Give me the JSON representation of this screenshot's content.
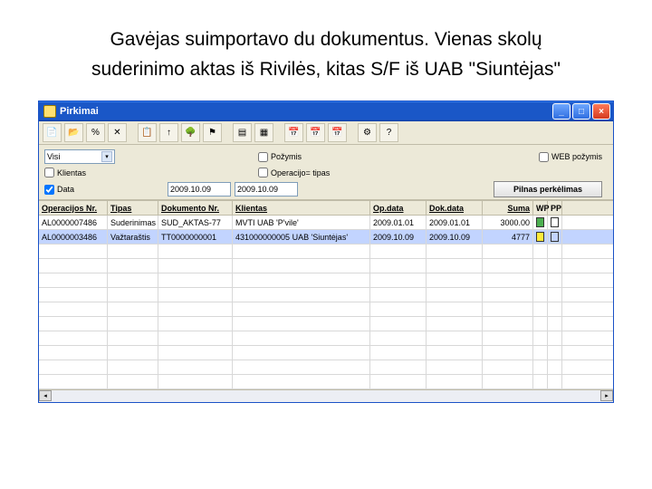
{
  "caption_line1": "Gavėjas suimportavo du dokumentus. Vienas skolų",
  "caption_line2": "suderinimo aktas iš Rivilės, kitas S/F iš UAB \"Siuntėjas\"",
  "window": {
    "title": "Pirkimai"
  },
  "filters": {
    "visi": "Visi",
    "klientas_label": "Klientas",
    "data_label": "Data",
    "date_from": "2009.10.09",
    "date_to": "2009.10.09",
    "pozymis": "Požymis",
    "operacijotipas": "Operacijo= tipas",
    "webpozymis": "WEB požymis",
    "pilnas": "Pilnas perkėlimas"
  },
  "columns": {
    "op": "Operacijos Nr.",
    "tip": "Tipas",
    "doc": "Dokumento Nr.",
    "kl": "Klientas",
    "opd": "Op.data",
    "dok": "Dok.data",
    "sum": "Suma",
    "wp": "WP",
    "pp": "PP"
  },
  "rows": [
    {
      "op": "AL0000007486",
      "tip": "Suderinimas",
      "doc": "SUD_AKTAS-77",
      "kl": "MVTI UAB 'P'vile'",
      "opd": "2009.01.01",
      "dok": "2009.01.01",
      "sum": "3000.00"
    },
    {
      "op": "AL0000003486",
      "tip": "Važtaraštis",
      "doc": "TT0000000001",
      "kl": "431000000005 UAB 'Siuntėjas'",
      "opd": "2009.10.09",
      "dok": "2009.10.09",
      "sum": "4777"
    }
  ]
}
